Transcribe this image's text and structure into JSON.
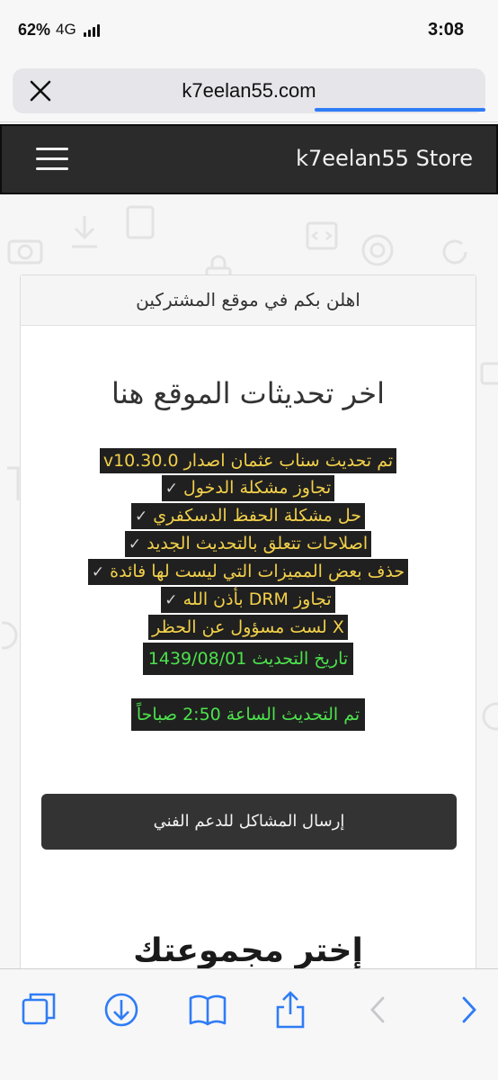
{
  "status": {
    "battery": "62%",
    "network": "4G",
    "time": "3:08"
  },
  "browser": {
    "url": "k7eelan55.com",
    "close_icon": "close-icon",
    "toolbar_icons": [
      "tabs-icon",
      "download-icon",
      "bookmarks-icon",
      "share-icon",
      "back-icon",
      "forward-icon"
    ]
  },
  "site": {
    "brand": "k7eelan55 Store",
    "menu_icon": "hamburger-menu-icon"
  },
  "panel": {
    "header": "اهلن بكم في موقع المشتركين",
    "headline": "اخر تحديثات الموقع هنا",
    "notes": [
      "تم تحديث سناب عثمان اصدار v10.30.0",
      "تجاوز مشكلة الدخول",
      "حل مشكلة الحفظ الدسكفري",
      "اصلاحات تتعلق بالتحديث الجديد",
      "حذف بعض المميزات التي ليست لها فائدة",
      "تجاوز DRM بأذن الله",
      "X لست مسؤول عن الحظر"
    ],
    "check_mark": "✓",
    "update_date": "تاريخ التحديث 1439/08/01",
    "update_time": "تم التحديث الساعة 2:50 صباحاً",
    "support_button": "إرسال المشاكل للدعم الفني",
    "choose_group": "إختر مجموعتك"
  },
  "colors": {
    "navbar": "#2b2b2b",
    "note_text": "#f2d04a",
    "green_text": "#4ce24c",
    "link_blue": "#2f7cf6"
  }
}
